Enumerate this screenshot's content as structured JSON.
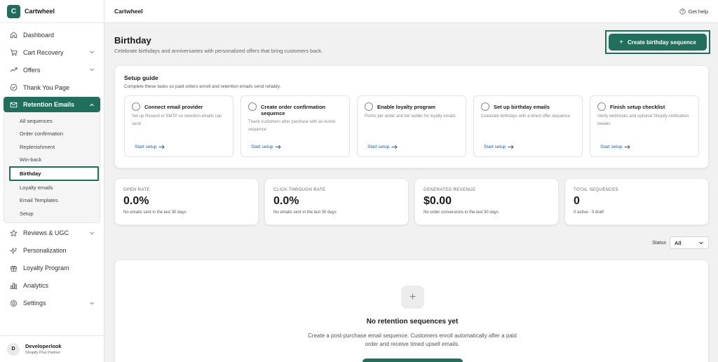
{
  "brand": {
    "logo_letter": "C",
    "name": "Cartwheel"
  },
  "sidebar": {
    "items": [
      {
        "label": "Dashboard",
        "icon": "home-icon",
        "chevron": false
      },
      {
        "label": "Cart Recovery",
        "icon": "cart-icon",
        "chevron": true
      },
      {
        "label": "Offers",
        "icon": "trend-icon",
        "chevron": true
      },
      {
        "label": "Thank You Page",
        "icon": "check-circle-icon",
        "chevron": false
      },
      {
        "label": "Retention Emails",
        "icon": "mail-icon",
        "chevron": true,
        "active": true
      },
      {
        "label": "Reviews & UGC",
        "icon": "star-icon",
        "chevron": true
      },
      {
        "label": "Personalization",
        "icon": "sparkle-icon",
        "chevron": false
      },
      {
        "label": "Loyalty Program",
        "icon": "gift-icon",
        "chevron": false
      },
      {
        "label": "Analytics",
        "icon": "bar-chart-icon",
        "chevron": false
      },
      {
        "label": "Settings",
        "icon": "gear-icon",
        "chevron": true
      }
    ],
    "subitems": [
      {
        "label": "All sequences"
      },
      {
        "label": "Order confirmation"
      },
      {
        "label": "Replenishment"
      },
      {
        "label": "Win-back"
      },
      {
        "label": "Birthday",
        "selected": true
      },
      {
        "label": "Loyalty emails"
      },
      {
        "label": "Email Templates"
      },
      {
        "label": "Setup"
      }
    ]
  },
  "user": {
    "initial": "D",
    "name": "Developerlook",
    "role": "Shopify Plus Partner"
  },
  "topbar": {
    "title": "Cartwheel",
    "help": "Get help"
  },
  "page": {
    "title": "Birthday",
    "subtitle": "Celebrate birthdays and anniversaries with personalized offers that bring customers back.",
    "cta": "Create birthday sequence"
  },
  "setup": {
    "title": "Setup guide",
    "subtitle": "Complete these tasks so paid orders enroll and retention emails send reliably.",
    "tasks": [
      {
        "title": "Connect email provider",
        "desc": "Set up Resend or SMTP so retention emails can send",
        "link": "Start setup"
      },
      {
        "title": "Create order confirmation sequence",
        "desc": "Thank customers after purchase with an Active sequence",
        "link": "Start setup"
      },
      {
        "title": "Enable loyalty program",
        "desc": "Points per dollar and tier ladder for loyalty emails",
        "link": "Start setup"
      },
      {
        "title": "Set up birthday emails",
        "desc": "Celebrate birthdays with a timed offer sequence",
        "link": "Start setup"
      },
      {
        "title": "Finish setup checklist",
        "desc": "Verify webhooks and optional Shopify notification tweaks",
        "link": "Start setup"
      }
    ]
  },
  "stats": [
    {
      "label": "OPEN RATE",
      "value": "0.0%",
      "note": "No emails sent in the last 30 days"
    },
    {
      "label": "CLICK-THROUGH RATE",
      "value": "0.0%",
      "note": "No emails sent in the last 30 days"
    },
    {
      "label": "GENERATED REVENUE",
      "value": "$0.00",
      "note": "No order conversions in the last 30 days"
    },
    {
      "label": "TOTAL SEQUENCES",
      "value": "0",
      "note": "0 active · 0 draft"
    }
  ],
  "filter": {
    "label": "Status",
    "value": "All"
  },
  "empty": {
    "title": "No retention sequences yet",
    "desc": "Create a post-purchase email sequence. Customers enroll automatically after a paid order and receive timed upsell emails."
  },
  "colors": {
    "accent": "#1f6f5c",
    "link": "#1a5fb4"
  }
}
